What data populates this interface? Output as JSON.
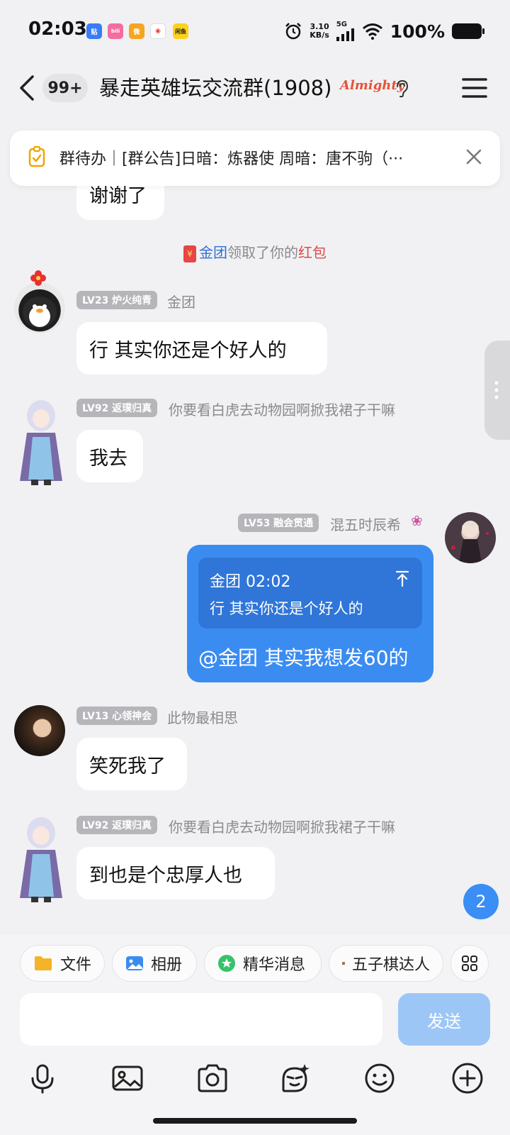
{
  "status_bar": {
    "time": "02:03",
    "apps": [
      {
        "icon": "tieba-app-icon",
        "label": "贴",
        "color": "#3a7cf6"
      },
      {
        "icon": "bilibili-app-icon",
        "label": "bili",
        "color": "#f46da0"
      },
      {
        "icon": "weibo-app-icon",
        "label": "微",
        "color": "#f4a623"
      },
      {
        "icon": "location-app-icon",
        "label": "◉",
        "color": "#e6403b"
      },
      {
        "icon": "xianyu-app-icon",
        "label": "闲鱼",
        "color": "#ffd21c"
      }
    ],
    "net_speed_value": "3.10",
    "net_speed_unit": "KB/s",
    "network": "5G",
    "battery": "100%"
  },
  "header": {
    "unread": "99+",
    "title": "暴走英雄坛交流群(1908)",
    "badge": "Almighty"
  },
  "announcement": {
    "text": "群待办｜[群公告]日暗：炼器使 周暗：唐不驹（···"
  },
  "messages": {
    "partial_bubble": "谢谢了",
    "system": {
      "name": "金团",
      "middle": "领取了你的",
      "suffix": "红包"
    },
    "m1": {
      "level": "LV23 炉火纯青",
      "name": "金团",
      "text": "行 其实你还是个好人的"
    },
    "m2": {
      "level": "LV92 返璞归真",
      "name": "你要看白虎去动物园啊掀我裙子干嘛",
      "text": "我去"
    },
    "m3": {
      "level": "LV53 融会贯通",
      "name": "混五时辰希",
      "quote_header": "金团 02:02",
      "quote_text": "行 其实你还是个好人的",
      "text": "@金团 其实我想发60的"
    },
    "m4": {
      "level": "LV13 心领神会",
      "name": "此物最相思",
      "text": "笑死我了"
    },
    "m5": {
      "level": "LV92 返璞归真",
      "name": "你要看白虎去动物园啊掀我裙子干嘛",
      "text": "到也是个忠厚人也"
    }
  },
  "new_msg_count": "2",
  "toolbar": {
    "chips": [
      "文件",
      "相册",
      "精华消息",
      "五子棋达人"
    ],
    "send": "发送"
  },
  "colors": {
    "accent": "#3b8cf1",
    "send_disabled": "#9cc6f6",
    "level_badge": "#b5b5ba"
  }
}
